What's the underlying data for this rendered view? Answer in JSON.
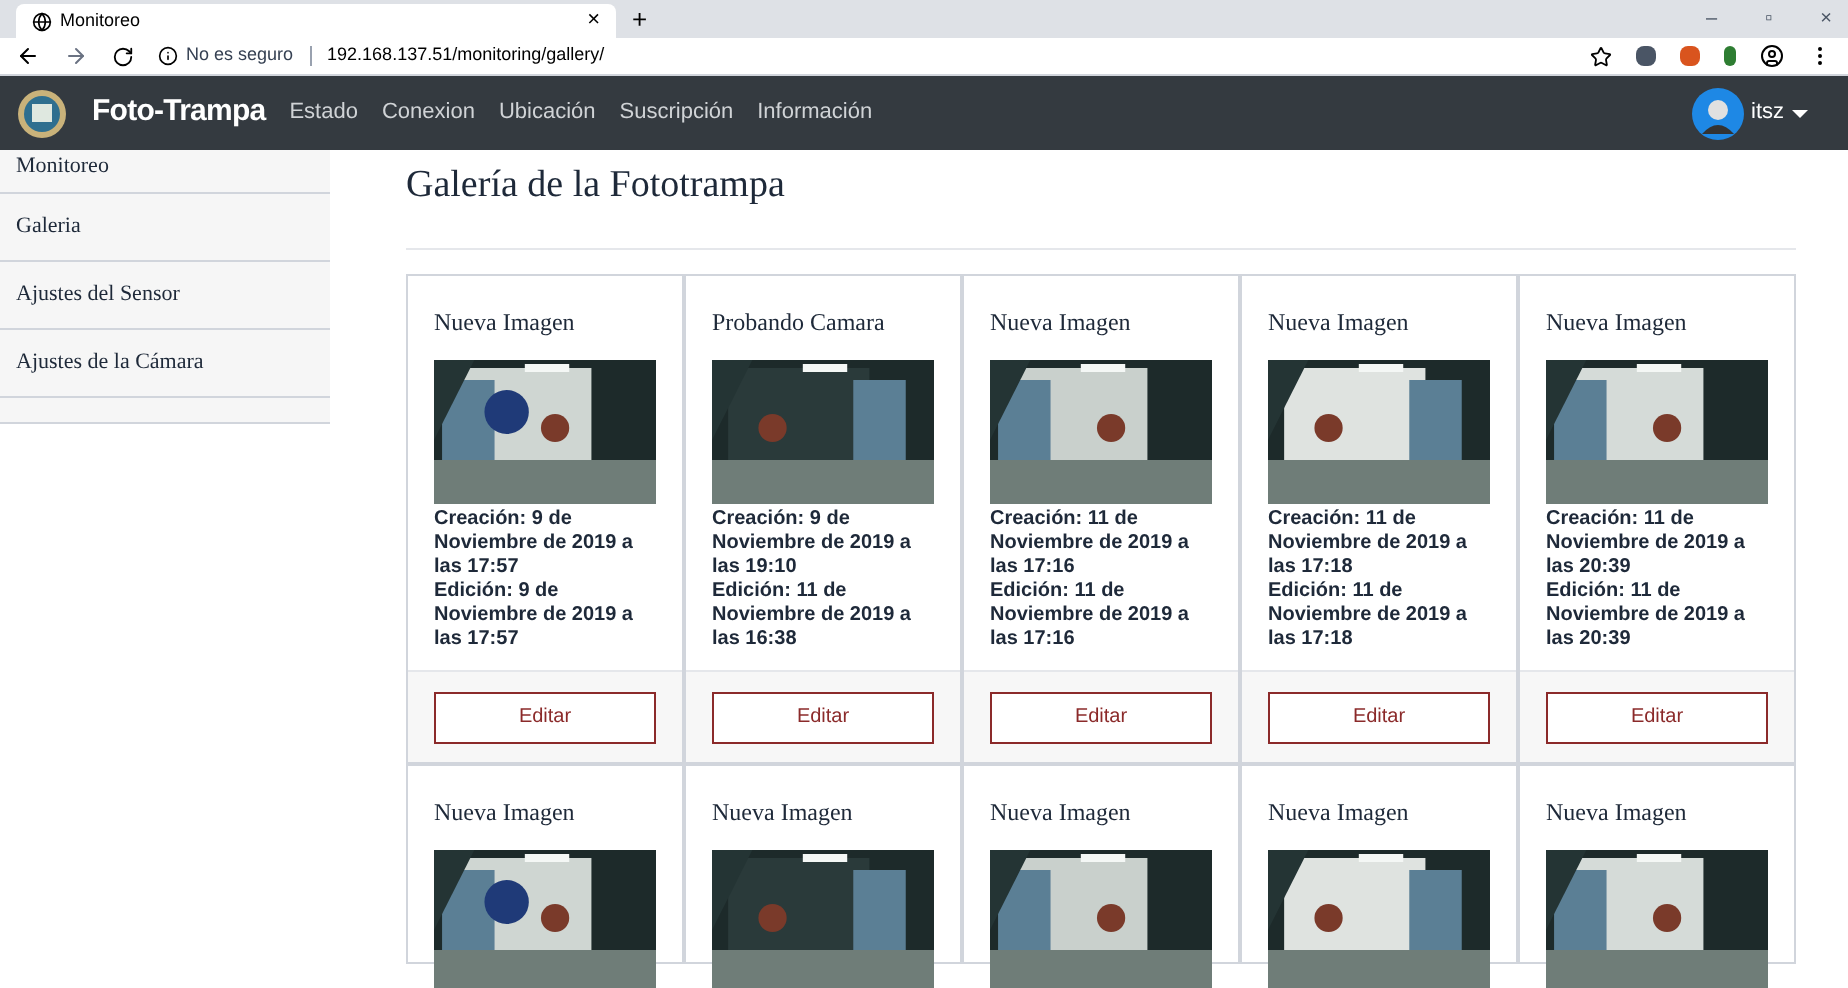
{
  "browser": {
    "tab_title": "Monitoreo",
    "tab_close": "×",
    "new_tab": "+",
    "window_controls": [
      "–",
      "▫",
      "×"
    ],
    "security": "No es seguro",
    "url": "192.168.137.51/monitoring/gallery/"
  },
  "navbar": {
    "brand": "Foto-Trampa",
    "links": [
      "Estado",
      "Conexion",
      "Ubicación",
      "Suscripción",
      "Información"
    ],
    "user": "itsz"
  },
  "sidebar": {
    "items": [
      "Monitoreo",
      "Galeria",
      "Ajustes del Sensor",
      "Ajustes de la Cámara"
    ]
  },
  "page_title": "Galería de la Fototrampa",
  "cards": [
    {
      "title": "Nueva Imagen",
      "created": "Creación: 9 de Noviembre de 2019 a las 17:57",
      "edited": "Edición: 9 de Noviembre de 2019 a las 17:57",
      "button": "Editar"
    },
    {
      "title": "Probando Camara",
      "created": "Creación: 9 de Noviembre de 2019 a las 19:10",
      "edited": "Edición: 11 de Noviembre de 2019 a las 16:38",
      "button": "Editar"
    },
    {
      "title": "Nueva Imagen",
      "created": "Creación: 11 de Noviembre de 2019 a las 17:16",
      "edited": "Edición: 11 de Noviembre de 2019 a las 17:16",
      "button": "Editar"
    },
    {
      "title": "Nueva Imagen",
      "created": "Creación: 11 de Noviembre de 2019 a las 17:18",
      "edited": "Edición: 11 de Noviembre de 2019 a las 17:18",
      "button": "Editar"
    },
    {
      "title": "Nueva Imagen",
      "created": "Creación: 11 de Noviembre de 2019 a las 20:39",
      "edited": "Edición: 11 de Noviembre de 2019 a las 20:39",
      "button": "Editar"
    },
    {
      "title": "Nueva Imagen"
    },
    {
      "title": "Nueva Imagen"
    },
    {
      "title": "Nueva Imagen"
    },
    {
      "title": "Nueva Imagen"
    },
    {
      "title": "Nueva Imagen"
    }
  ]
}
